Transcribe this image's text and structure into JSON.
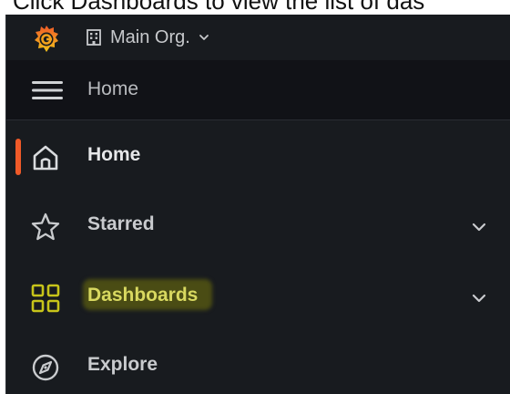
{
  "caption": "Click Dashboards to view the list of das",
  "org": {
    "name": "Main Org.",
    "building_icon": "building-icon",
    "chevron_icon": "chevron-down-icon"
  },
  "logo_icon": "grafana-logo",
  "breadcrumb": {
    "title": "Home",
    "menu_icon": "hamburger-icon"
  },
  "nav": {
    "items": [
      {
        "label": "Home",
        "icon": "home-icon",
        "active": true
      },
      {
        "label": "Starred",
        "icon": "star-icon",
        "expandable": true
      },
      {
        "label": "Dashboards",
        "icon": "dashboards-icon",
        "expandable": true,
        "highlighted": true
      },
      {
        "label": "Explore",
        "icon": "explore-icon"
      }
    ]
  },
  "colors": {
    "panel_bg": "#181b1f",
    "breadbar_bg": "#111217",
    "active_accent": "#f05a28",
    "highlight": "#4a4c14",
    "highlight_text": "#d8d860"
  }
}
